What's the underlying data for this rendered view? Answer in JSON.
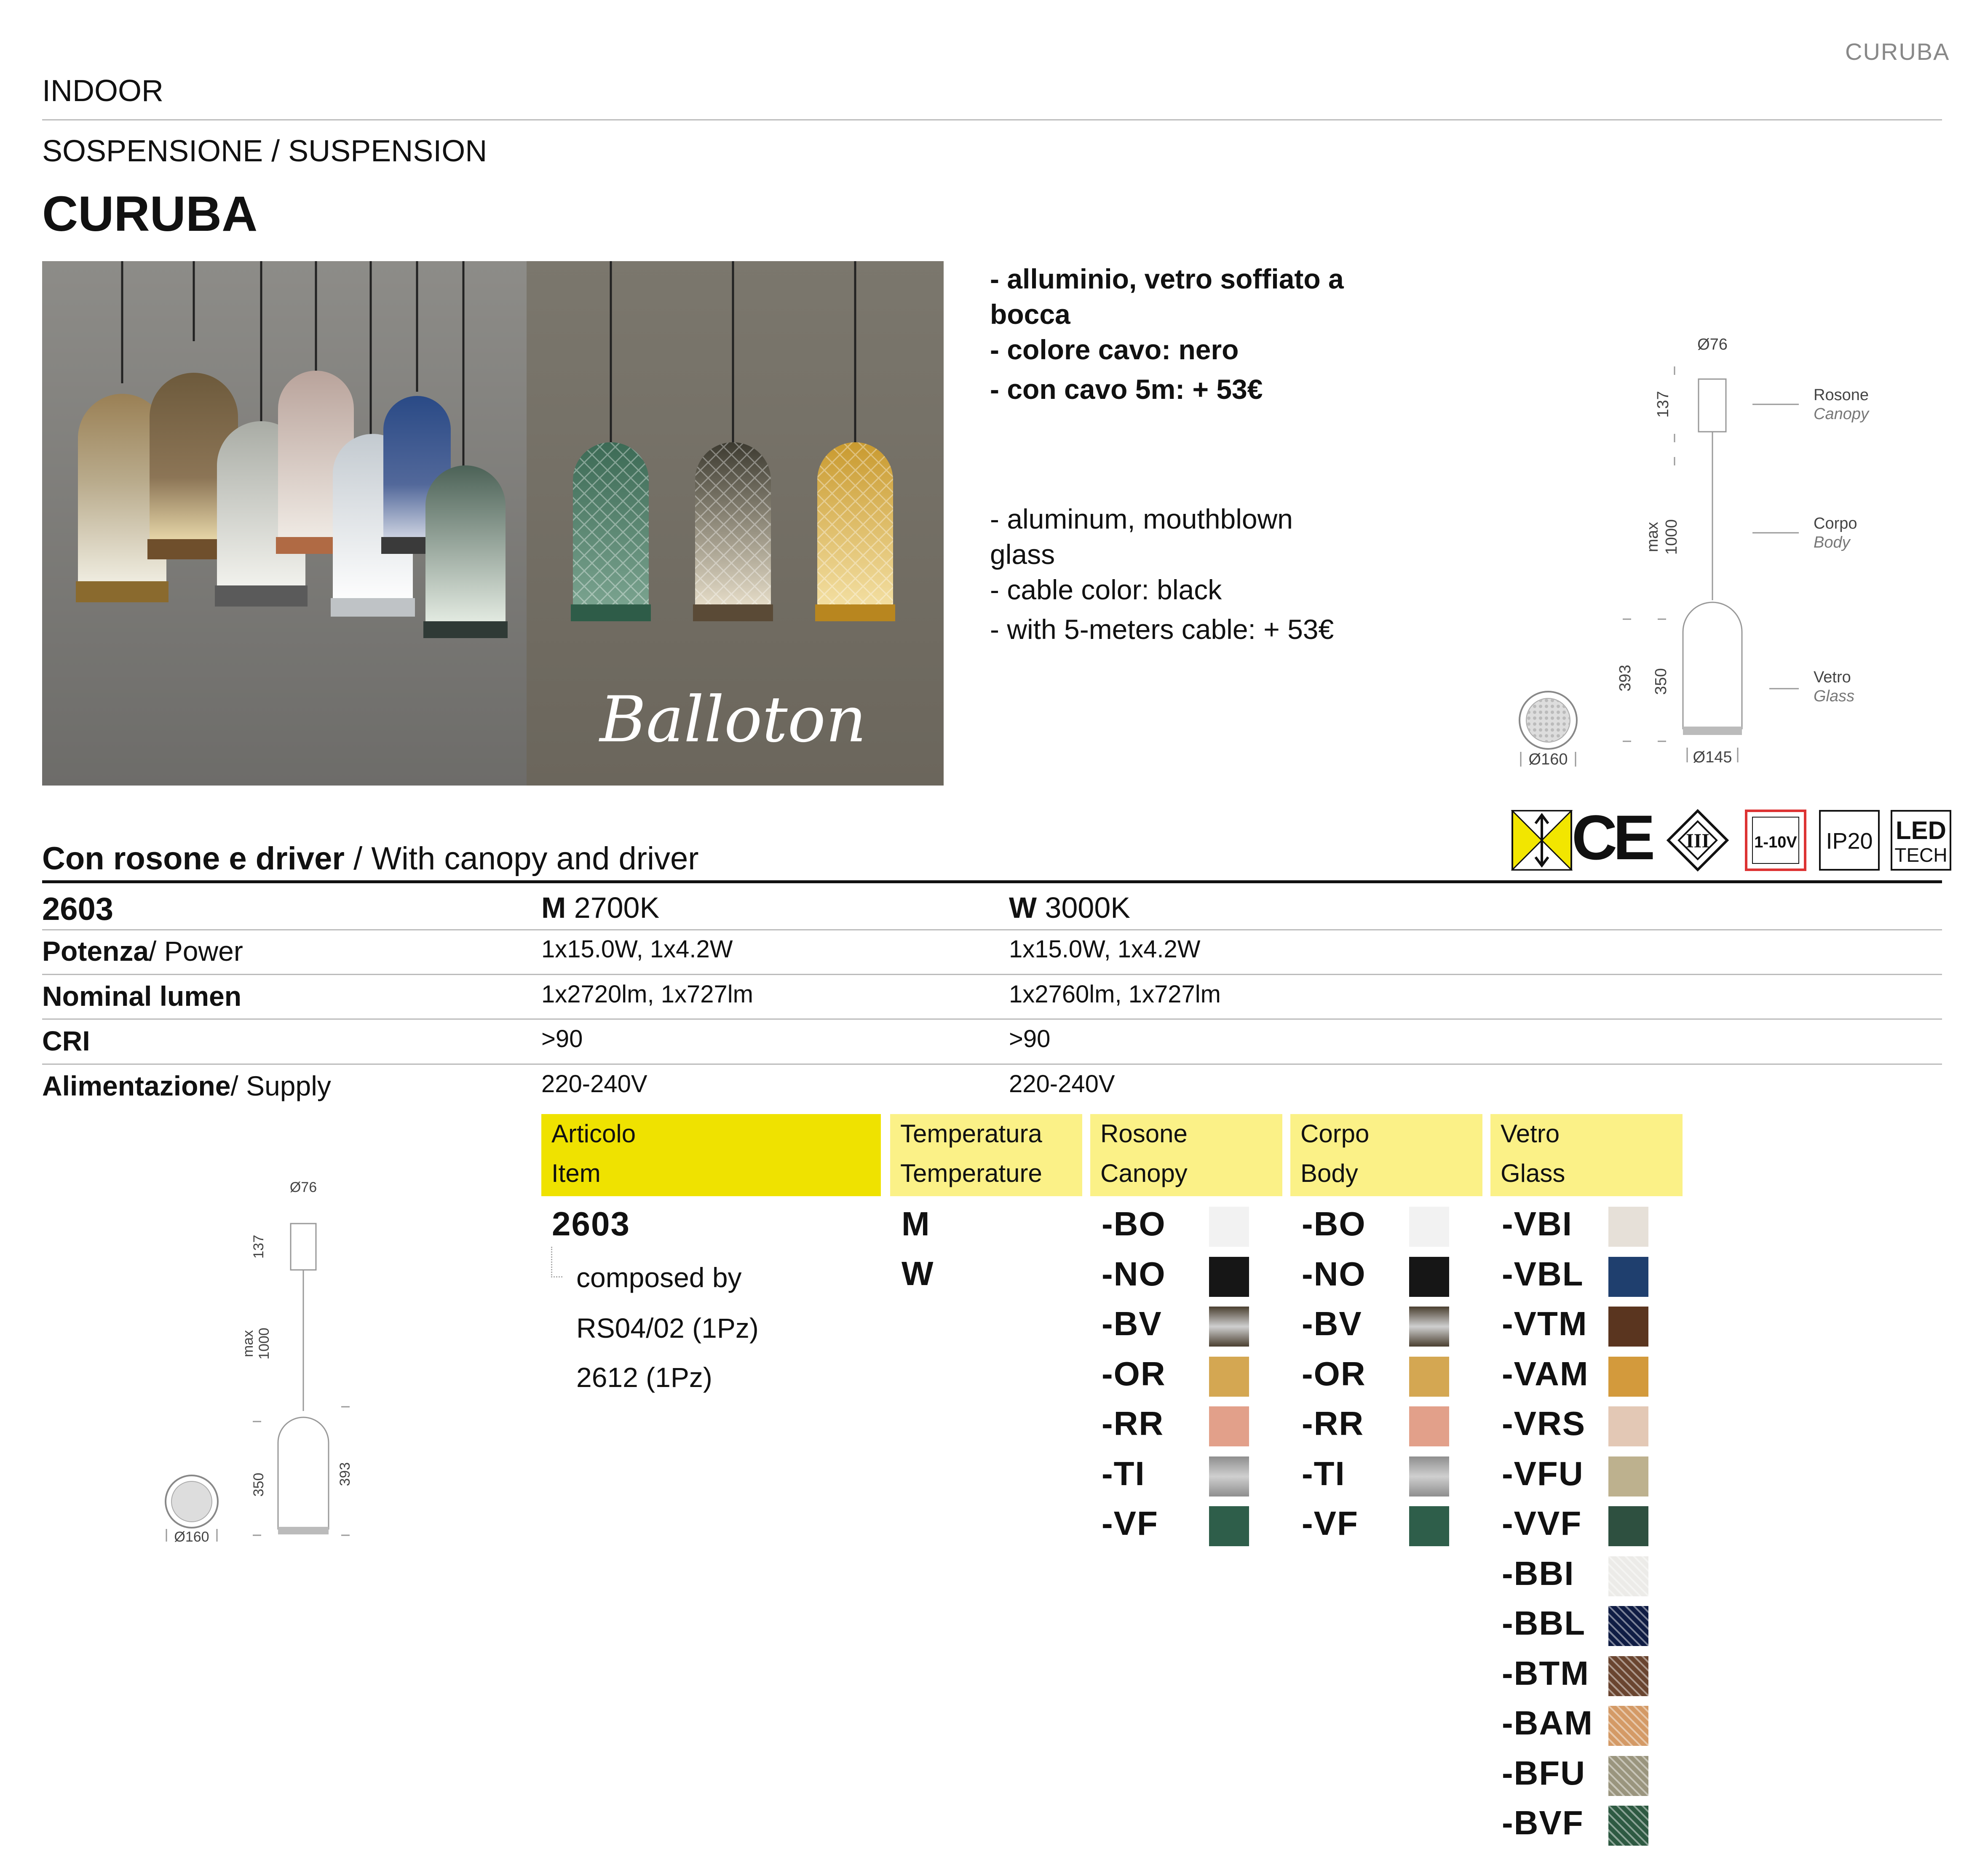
{
  "header": {
    "brand": "CURUBA",
    "section": "INDOOR",
    "category": "SOSPENSIONE / SUSPENSION",
    "title": "CURUBA"
  },
  "photo": {
    "logo_text": "Balloton"
  },
  "description_it": {
    "lines": [
      "- alluminio, vetro soffiato a",
      "bocca",
      "- colore cavo: nero",
      "- con cavo 5m: + 53€"
    ]
  },
  "description_en": {
    "lines": [
      "- aluminum, mouthblown",
      "glass",
      "- cable color: black",
      "- with 5-meters cable: + 53€"
    ]
  },
  "drawing": {
    "canopy_diam": "Ø76",
    "canopy_h": "137",
    "cable_max": "max",
    "cable_len": "1000",
    "glass_total": "393",
    "glass_h": "350",
    "base_diam": "Ø145",
    "top_diam": "Ø160",
    "label_rosone": "Rosone",
    "label_canopy": "Canopy",
    "label_corpo": "Corpo",
    "label_body": "Body",
    "label_vetro": "Vetro",
    "label_glass": "Glass"
  },
  "certs": {
    "ce": "CE",
    "class": "III",
    "dim": "1-10V",
    "ip": "IP20",
    "led": "LED",
    "tech": "TECH"
  },
  "spec": {
    "heading_bold": "Con rosone e driver",
    "heading_rest": " / With canopy and driver",
    "code": "2603",
    "m_label": "M",
    "m_value": " 2700K",
    "w_label": "W",
    "w_value": " 3000K",
    "rows": [
      {
        "label_bold": "Potenza",
        "label_rest": "/ Power",
        "m": "1x15.0W, 1x4.2W",
        "w": "1x15.0W, 1x4.2W"
      },
      {
        "label_bold": "Nominal lumen",
        "label_rest": "",
        "m": "1x2720lm, 1x727lm",
        "w": "1x2760lm, 1x727lm"
      },
      {
        "label_bold": "CRI",
        "label_rest": "",
        "m": ">90",
        "w": ">90"
      },
      {
        "label_bold": "Alimentazione",
        "label_rest": "/ Supply",
        "m": "220-240V",
        "w": "220-240V"
      }
    ]
  },
  "matrix": {
    "headers": [
      {
        "l1": "Articolo",
        "l2": "Item"
      },
      {
        "l1": "Temperatura",
        "l2": "Temperature"
      },
      {
        "l1": "Rosone",
        "l2": "Canopy"
      },
      {
        "l1": "Corpo",
        "l2": "Body"
      },
      {
        "l1": "Vetro",
        "l2": "Glass"
      }
    ],
    "item": "2603",
    "composed": "composed by",
    "parts": [
      "RS04/02 (1Pz)",
      "2612 (1Pz)"
    ],
    "temps": [
      "M",
      "W"
    ],
    "finishes": [
      "-BO",
      "-NO",
      "-BV",
      "-OR",
      "-RR",
      "-TI",
      "-VF"
    ],
    "finish_colors": [
      "#f2f2f2",
      "#161616",
      "#4a3f30",
      "#d4a752",
      "#e2a08a",
      "#8e8e8e",
      "#2e5e4a"
    ],
    "glass": [
      "-VBI",
      "-VBL",
      "-VTM",
      "-VAM",
      "-VRS",
      "-VFU",
      "-VVF",
      "-BBI",
      "-BBL",
      "-BTM",
      "-BAM",
      "-BFU",
      "-BVF"
    ],
    "glass_colors": [
      "#e6e0d8",
      "#1f3f6e",
      "#5a351f",
      "#d39a3c",
      "#e3c8b5",
      "#bdb18e",
      "#2e5040",
      "#ecebe8",
      "#0f1c44",
      "#6a4530",
      "#d49a66",
      "#9a957e",
      "#2e5a42"
    ]
  }
}
